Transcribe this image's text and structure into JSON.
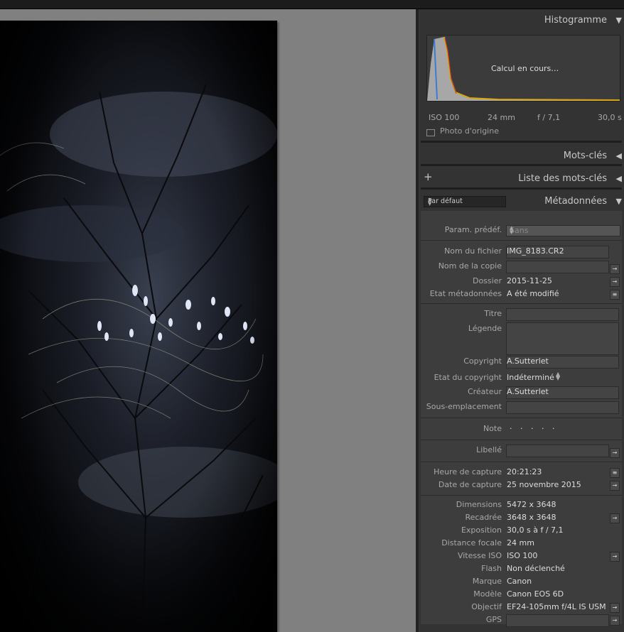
{
  "panels": {
    "histogram": {
      "title": "Histogramme",
      "status": "Calcul en cours…",
      "iso": "ISO 100",
      "focal": "24 mm",
      "aperture": "f / 7,1",
      "shutter": "30,0 s",
      "original_photo": "Photo d'origine"
    },
    "keywords": {
      "title": "Mots-clés"
    },
    "keyword_list": {
      "title": "Liste des mots-clés"
    },
    "metadata": {
      "title": "Métadonnées",
      "preset_selector": "Par défaut",
      "preset_label": "Param. prédéf.",
      "preset_value": "Sans",
      "fields": {
        "filename": {
          "label": "Nom du fichier",
          "value": "IMG_8183.CR2"
        },
        "copy_name": {
          "label": "Nom de la copie",
          "value": ""
        },
        "folder": {
          "label": "Dossier",
          "value": "2015-11-25"
        },
        "metadata_status": {
          "label": "Etat métadonnées",
          "value": "A été modifié"
        },
        "title": {
          "label": "Titre",
          "value": ""
        },
        "caption": {
          "label": "Légende",
          "value": ""
        },
        "copyright": {
          "label": "Copyright",
          "value": "A.Sutterlet"
        },
        "copyright_status": {
          "label": "Etat du copyright",
          "value": "Indéterminé"
        },
        "creator": {
          "label": "Créateur",
          "value": "A.Sutterlet"
        },
        "sublocation": {
          "label": "Sous-emplacement",
          "value": ""
        },
        "rating": {
          "label": "Note",
          "value": "· · · · ·"
        },
        "label": {
          "label": "Libellé",
          "value": ""
        },
        "capture_time": {
          "label": "Heure de capture",
          "value": "20:21:23"
        },
        "capture_date": {
          "label": "Date de capture",
          "value": "25 novembre 2015"
        },
        "dimensions": {
          "label": "Dimensions",
          "value": "5472 x 3648"
        },
        "cropped": {
          "label": "Recadrée",
          "value": "3648 x 3648"
        },
        "exposure": {
          "label": "Exposition",
          "value": "30,0 s à f / 7,1"
        },
        "focal_length": {
          "label": "Distance focale",
          "value": "24 mm"
        },
        "iso_speed": {
          "label": "Vitesse ISO",
          "value": "ISO 100"
        },
        "flash": {
          "label": "Flash",
          "value": "Non déclenché"
        },
        "make": {
          "label": "Marque",
          "value": "Canon"
        },
        "model": {
          "label": "Modèle",
          "value": "Canon EOS 6D"
        },
        "lens": {
          "label": "Objectif",
          "value": "EF24-105mm f/4L IS USM"
        },
        "gps": {
          "label": "GPS",
          "value": ""
        }
      }
    }
  },
  "icons": {
    "collapse": "triangle-down-icon",
    "expand": "triangle-left-icon",
    "goto": "arrow-right-icon",
    "list": "list-icon"
  }
}
